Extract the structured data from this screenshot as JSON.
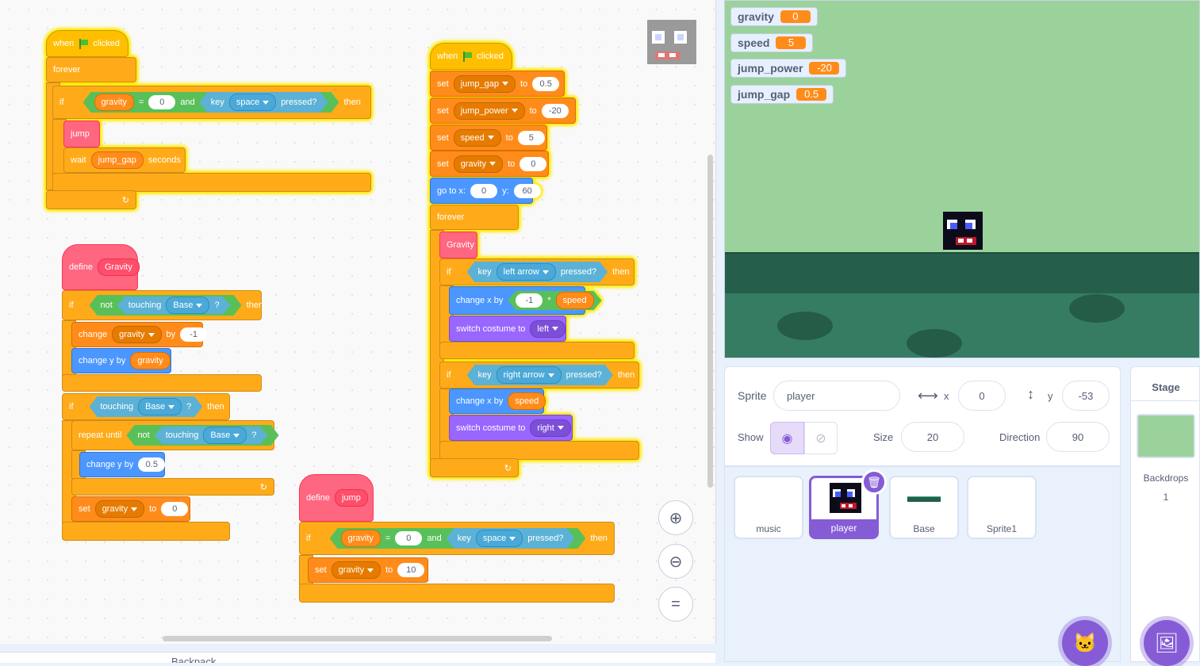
{
  "code": {
    "s1": {
      "when": "when",
      "clicked": "clicked",
      "forever": "forever",
      "if": "if",
      "gravity": "gravity",
      "eq": "=",
      "zero": "0",
      "and": "and",
      "key": "key",
      "space": "space",
      "pressed": "pressed?",
      "then": "then",
      "jump": "jump",
      "wait": "wait",
      "jump_gap": "jump_gap",
      "seconds": "seconds"
    },
    "s2": {
      "when": "when",
      "clicked": "clicked",
      "set": "set",
      "to": "to",
      "jump_gap": "jump_gap",
      "jump_gap_val": "0.5",
      "jump_power": "jump_power",
      "jump_power_val": "-20",
      "speed": "speed",
      "speed_val": "5",
      "gravity": "gravity",
      "gravity_val": "0",
      "goto": "go to x:",
      "x_val": "0",
      "y_lbl": "y:",
      "y_val": "60",
      "forever": "forever",
      "Gravity": "Gravity",
      "if": "if",
      "key": "key",
      "left_arrow": "left arrow",
      "pressed": "pressed?",
      "then": "then",
      "change_x": "change x by",
      "neg1": "-1",
      "times": "*",
      "speed_rep": "speed",
      "switch": "switch costume to",
      "left": "left",
      "right_arrow": "right arrow",
      "right": "right"
    },
    "s3": {
      "define": "define",
      "Gravity": "Gravity",
      "if": "if",
      "not": "not",
      "touching": "touching",
      "Base": "Base",
      "q": "?",
      "then": "then",
      "change": "change",
      "gravity": "gravity",
      "by": "by",
      "neg1": "-1",
      "change_y": "change y by",
      "repeat_until": "repeat until",
      "half": "0.5",
      "set": "set",
      "to": "to",
      "zero": "0"
    },
    "s4": {
      "define": "define",
      "jump": "jump",
      "if": "if",
      "gravity": "gravity",
      "eq": "=",
      "zero": "0",
      "and": "and",
      "key": "key",
      "space": "space",
      "pressed": "pressed?",
      "then": "then",
      "set": "set",
      "to": "to",
      "ten": "10"
    }
  },
  "monitors": [
    {
      "name": "gravity",
      "value": "0"
    },
    {
      "name": "speed",
      "value": "5"
    },
    {
      "name": "jump_power",
      "value": "-20"
    },
    {
      "name": "jump_gap",
      "value": "0.5"
    }
  ],
  "sprite_info": {
    "sprite_label": "Sprite",
    "sprite_name": "player",
    "x_label": "x",
    "x_value": "0",
    "y_label": "y",
    "y_value": "-53",
    "show_label": "Show",
    "size_label": "Size",
    "size_value": "20",
    "direction_label": "Direction",
    "direction_value": "90"
  },
  "sprites": [
    "music",
    "player",
    "Base",
    "Sprite1"
  ],
  "stage_panel": {
    "title": "Stage",
    "backdrops_label": "Backdrops",
    "backdrops_count": "1"
  },
  "bottom_partial": "Backpack",
  "colors": {
    "events": "#ffbf00",
    "control": "#ffab19",
    "variables": "#ff8c1a",
    "motion": "#4c97ff",
    "looks": "#9966ff",
    "myblocks": "#ff6680",
    "operators": "#59c059",
    "sensing": "#5cb1d6",
    "selected": "#855cd6",
    "stage_bg": "#9bd29b"
  }
}
